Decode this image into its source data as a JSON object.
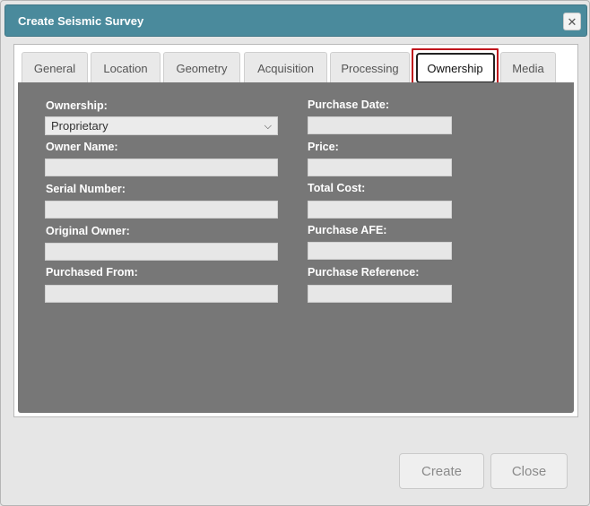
{
  "dialog": {
    "title": "Create Seismic Survey",
    "close_glyph": "✕"
  },
  "tabs": [
    {
      "label": "General"
    },
    {
      "label": "Location"
    },
    {
      "label": "Geometry"
    },
    {
      "label": "Acquisition"
    },
    {
      "label": "Processing"
    },
    {
      "label": "Ownership",
      "active": true
    },
    {
      "label": "Media"
    }
  ],
  "form": {
    "left": {
      "ownership_label": "Ownership:",
      "ownership_value": "Proprietary",
      "owner_name_label": "Owner Name:",
      "owner_name_value": "",
      "serial_number_label": "Serial Number:",
      "serial_number_value": "",
      "original_owner_label": "Original Owner:",
      "original_owner_value": "",
      "purchased_from_label": "Purchased From:",
      "purchased_from_value": ""
    },
    "right": {
      "purchase_date_label": "Purchase Date:",
      "purchase_date_value": "",
      "price_label": "Price:",
      "price_value": "",
      "total_cost_label": "Total Cost:",
      "total_cost_value": "",
      "purchase_afe_label": "Purchase AFE:",
      "purchase_afe_value": "",
      "purchase_reference_label": "Purchase Reference:",
      "purchase_reference_value": ""
    }
  },
  "buttons": {
    "create_label": "Create",
    "close_label": "Close"
  },
  "icons": {
    "close": "close-icon",
    "dropdown": "chevron-down-icon"
  },
  "colors": {
    "titlebar": "#4a8a9c",
    "content_bg": "#777777",
    "active_tab_outline": "#c0141c"
  }
}
